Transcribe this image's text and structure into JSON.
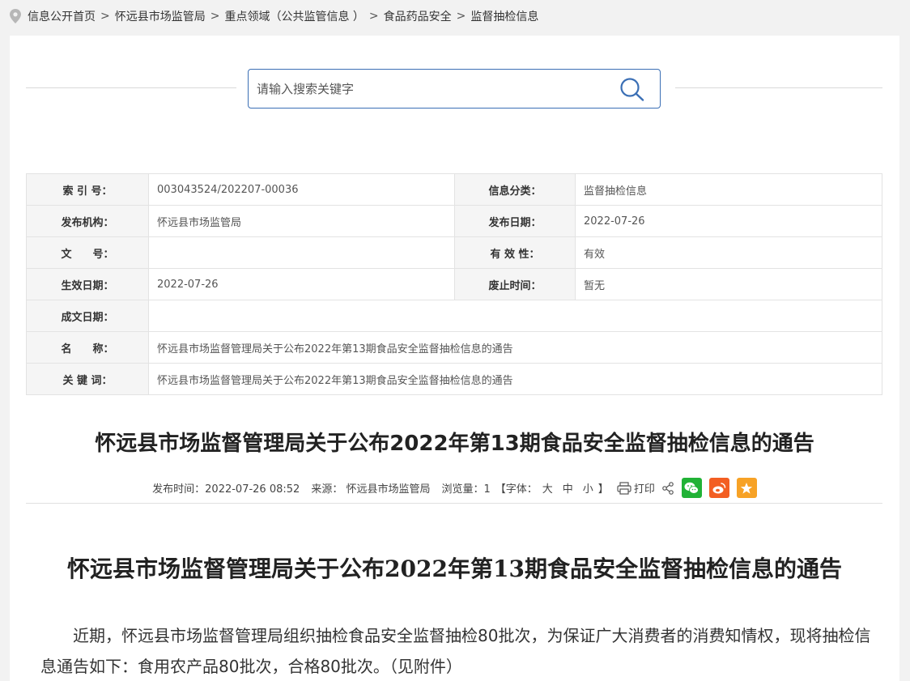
{
  "breadcrumb": {
    "items": [
      "信息公开首页",
      "怀远县市场监管局",
      "重点领域（公共监管信息 ）",
      "食品药品安全",
      "监督抽检信息"
    ],
    "separator": ">"
  },
  "search": {
    "placeholder": "请输入搜索关键字"
  },
  "meta": {
    "index_label": "索 引 号：",
    "index_value": "003043524/202207-00036",
    "category_label": "信息分类：",
    "category_value": "监督抽检信息",
    "publisher_label": "发布机构：",
    "publisher_value": "怀远县市场监管局",
    "pubdate_label": "发布日期：",
    "pubdate_value": "2022-07-26",
    "docno_label": "文　　号：",
    "docno_value": "",
    "validity_label": "有 效 性：",
    "validity_value": "有效",
    "effdate_label": "生效日期：",
    "effdate_value": "2022-07-26",
    "abolish_label": "废止时间：",
    "abolish_value": "暂无",
    "written_label": "成文日期：",
    "written_value": "",
    "name_label": "名　　称：",
    "name_value": "怀远县市场监督管理局关于公布2022年第13期食品安全监督抽检信息的通告",
    "keywords_label": "关 键 词：",
    "keywords_value": "怀远县市场监督管理局关于公布2022年第13期食品安全监督抽检信息的通告"
  },
  "article": {
    "title": "怀远县市场监督管理局关于公布2022年第13期食品安全监督抽检信息的通告",
    "publish_time": "发布时间：2022-07-26 08:52",
    "source": "来源： 怀远县市场监管局",
    "views": "浏览量：1",
    "font_prefix": "【字体：",
    "font_large": "大",
    "font_medium": "中",
    "font_small": "小",
    "font_suffix": "】",
    "print_label": "打印",
    "doc_title": "怀远县市场监督管理局关于公布2022年第13期食品安全监督抽检信息的通告",
    "paragraph": "近期，怀远县市场监督管理局组织抽检食品安全监督抽检80批次，为保证广大消费者的消费知情权，现将抽检信息通告如下：食用农产品80批次，合格80批次。（见附件）"
  },
  "colors": {
    "search_border": "#3b6fb5",
    "wechat": "#21b236",
    "weibo": "#f35e22",
    "favorite": "#f7a226"
  }
}
